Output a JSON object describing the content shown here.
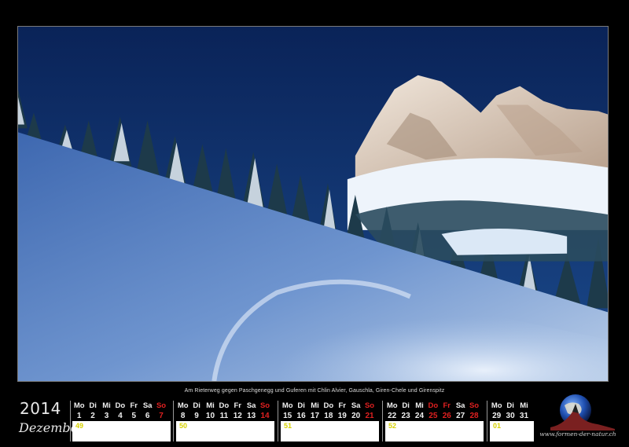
{
  "caption": "Am Rieterweg gegen Paschgenegg und Guferen mit Chlin Alvier, Gauschla, Giren-Chele und Girenspitz",
  "calendar": {
    "year": "2014",
    "month": "Dezember",
    "weeks": [
      {
        "kw": "49",
        "days": [
          {
            "n": "Mo",
            "d": "1"
          },
          {
            "n": "Di",
            "d": "2"
          },
          {
            "n": "Mi",
            "d": "3"
          },
          {
            "n": "Do",
            "d": "4"
          },
          {
            "n": "Fr",
            "d": "5"
          },
          {
            "n": "Sa",
            "d": "6"
          },
          {
            "n": "So",
            "d": "7",
            "red": true
          }
        ]
      },
      {
        "kw": "50",
        "days": [
          {
            "n": "Mo",
            "d": "8"
          },
          {
            "n": "Di",
            "d": "9"
          },
          {
            "n": "Mi",
            "d": "10"
          },
          {
            "n": "Do",
            "d": "11"
          },
          {
            "n": "Fr",
            "d": "12"
          },
          {
            "n": "Sa",
            "d": "13"
          },
          {
            "n": "So",
            "d": "14",
            "red": true
          }
        ]
      },
      {
        "kw": "51",
        "days": [
          {
            "n": "Mo",
            "d": "15"
          },
          {
            "n": "Di",
            "d": "16"
          },
          {
            "n": "Mi",
            "d": "17"
          },
          {
            "n": "Do",
            "d": "18"
          },
          {
            "n": "Fr",
            "d": "19"
          },
          {
            "n": "Sa",
            "d": "20"
          },
          {
            "n": "So",
            "d": "21",
            "red": true
          }
        ]
      },
      {
        "kw": "52",
        "days": [
          {
            "n": "Mo",
            "d": "22"
          },
          {
            "n": "Di",
            "d": "23"
          },
          {
            "n": "Mi",
            "d": "24"
          },
          {
            "n": "Do",
            "d": "25",
            "red": true
          },
          {
            "n": "Fr",
            "d": "26",
            "red": true
          },
          {
            "n": "Sa",
            "d": "27"
          },
          {
            "n": "So",
            "d": "28",
            "red": true
          }
        ]
      },
      {
        "kw": "01",
        "days": [
          {
            "n": "Mo",
            "d": "29"
          },
          {
            "n": "Di",
            "d": "30"
          },
          {
            "n": "Mi",
            "d": "31"
          }
        ]
      }
    ]
  },
  "logo": {
    "url": "www.formen-der-natur.ch",
    "icon": "globe-mountain-icon"
  },
  "colors": {
    "sunday": "#e02020",
    "week_number": "#d7d200",
    "sky": "#0d2f6e",
    "snow": "#d8e6f5"
  }
}
